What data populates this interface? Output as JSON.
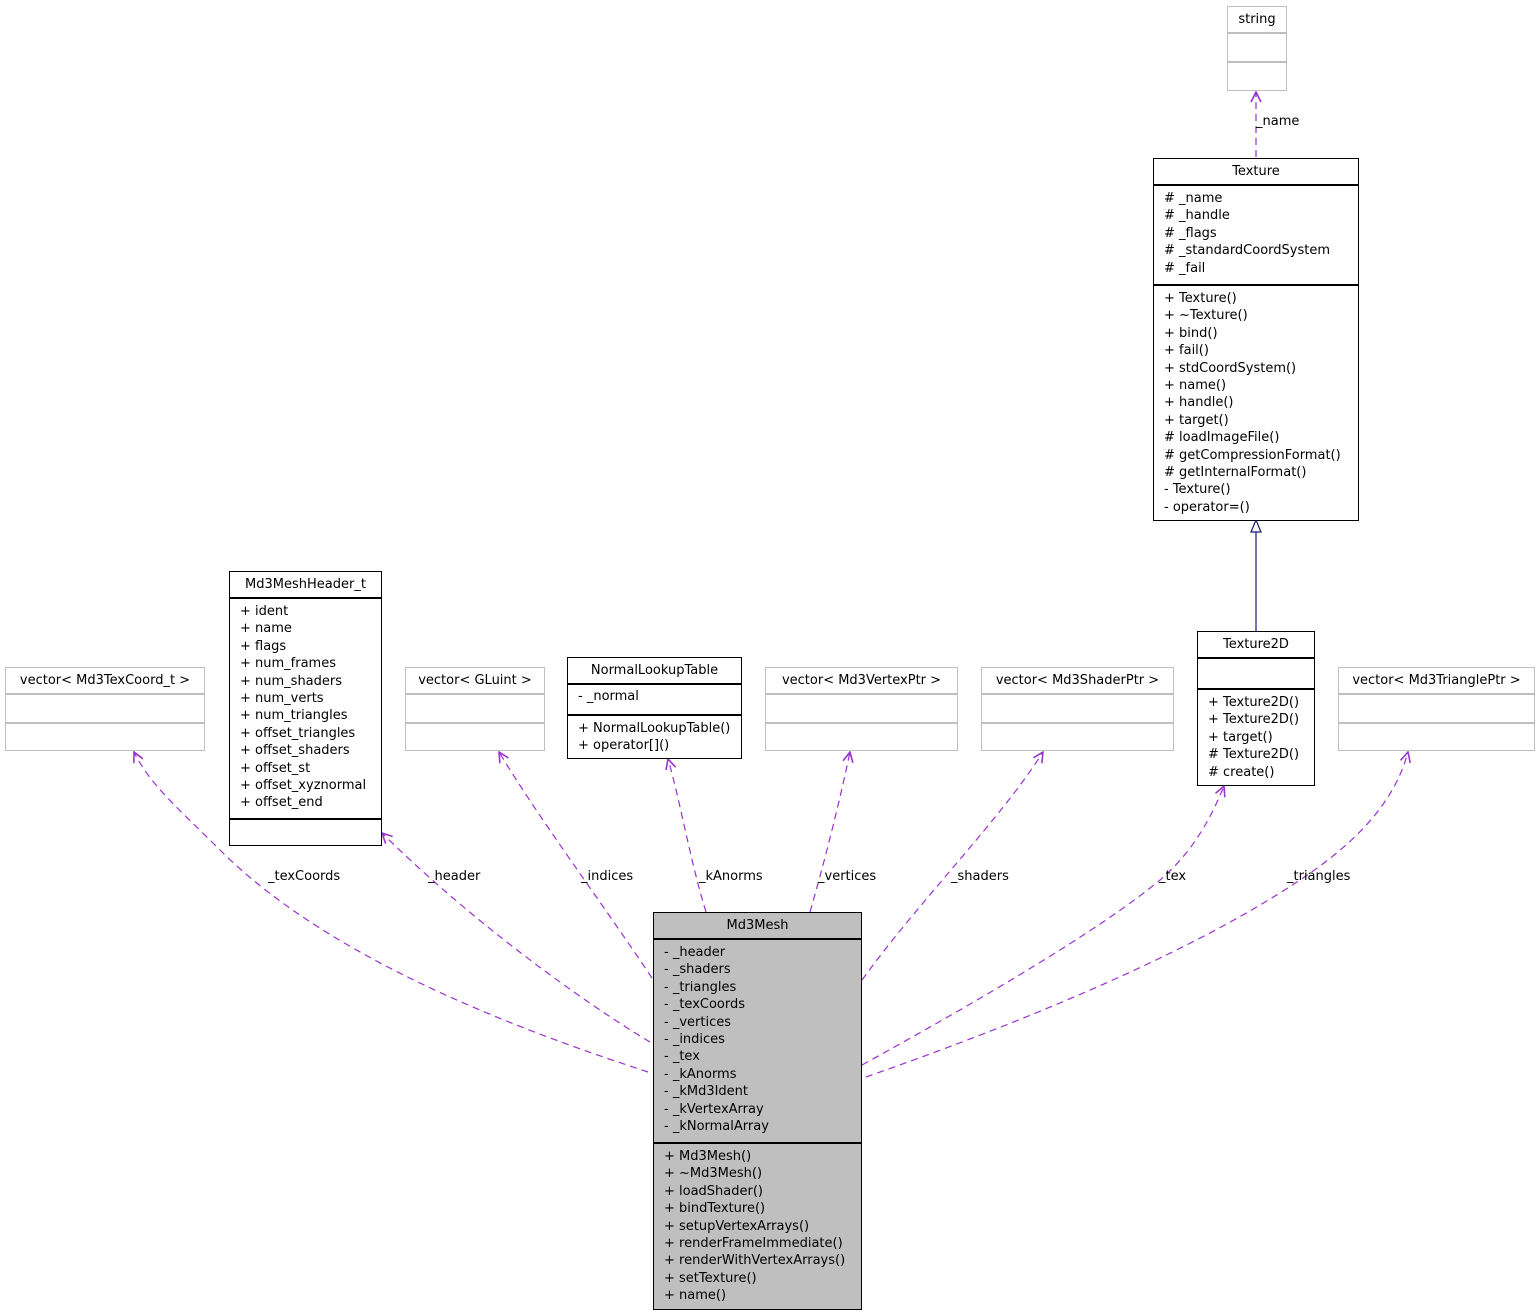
{
  "diagram": {
    "type": "uml-collaboration",
    "colors": {
      "usage_edge": "#9a32cd",
      "inheritance_edge": "#191970",
      "focus_fill": "#bfbfbf",
      "external_border": "#bfbfbf"
    },
    "classes": {
      "string": {
        "name": "string",
        "attributes": [],
        "methods": []
      },
      "texture": {
        "name": "Texture",
        "attributes": [
          "# _name",
          "# _handle",
          "# _flags",
          "# _standardCoordSystem",
          "# _fail"
        ],
        "methods": [
          "+ Texture()",
          "+ ~Texture()",
          "+ bind()",
          "+ fail()",
          "+ stdCoordSystem()",
          "+ name()",
          "+ handle()",
          "+ target()",
          "# loadImageFile()",
          "# getCompressionFormat()",
          "# getInternalFormat()",
          "- Texture()",
          "- operator=()"
        ]
      },
      "texture2d": {
        "name": "Texture2D",
        "attributes": [],
        "methods": [
          "+ Texture2D()",
          "+ Texture2D()",
          "+ target()",
          "# Texture2D()",
          "# create()"
        ]
      },
      "md3meshheader": {
        "name": "Md3MeshHeader_t",
        "attributes": [
          "+ ident",
          "+ name",
          "+ flags",
          "+ num_frames",
          "+ num_shaders",
          "+ num_verts",
          "+ num_triangles",
          "+ offset_triangles",
          "+ offset_shaders",
          "+ offset_st",
          "+ offset_xyznormal",
          "+ offset_end"
        ],
        "methods": []
      },
      "normallookup": {
        "name": "NormalLookupTable",
        "attributes": [
          "- _normal"
        ],
        "methods": [
          "+ NormalLookupTable()",
          "+ operator[]()"
        ]
      },
      "vec_texcoord": {
        "name": "vector< Md3TexCoord_t >",
        "attributes": [],
        "methods": []
      },
      "vec_gluint": {
        "name": "vector< GLuint >",
        "attributes": [],
        "methods": []
      },
      "vec_vertex": {
        "name": "vector< Md3VertexPtr >",
        "attributes": [],
        "methods": []
      },
      "vec_shader": {
        "name": "vector< Md3ShaderPtr >",
        "attributes": [],
        "methods": []
      },
      "vec_triangle": {
        "name": "vector< Md3TrianglePtr >",
        "attributes": [],
        "methods": []
      },
      "md3mesh": {
        "name": "Md3Mesh",
        "attributes": [
          "- _header",
          "- _shaders",
          "- _triangles",
          "- _texCoords",
          "- _vertices",
          "- _indices",
          "- _tex",
          "- _kAnorms",
          "- _kMd3Ident",
          "- _kVertexArray",
          "- _kNormalArray"
        ],
        "methods": [
          "+ Md3Mesh()",
          "+ ~Md3Mesh()",
          "+ loadShader()",
          "+ bindTexture()",
          "+ setupVertexArrays()",
          "+ renderFrameImmediate()",
          "+ renderWithVertexArrays()",
          "+ setTexture()",
          "+ name()"
        ]
      }
    },
    "edges": [
      {
        "from": "texture",
        "to": "string",
        "kind": "usage",
        "label": "_name"
      },
      {
        "from": "texture2d",
        "to": "texture",
        "kind": "inheritance",
        "label": ""
      },
      {
        "from": "md3mesh",
        "to": "vec_texcoord",
        "kind": "usage",
        "label": "_texCoords"
      },
      {
        "from": "md3mesh",
        "to": "md3meshheader",
        "kind": "usage",
        "label": "_header"
      },
      {
        "from": "md3mesh",
        "to": "vec_gluint",
        "kind": "usage",
        "label": "_indices"
      },
      {
        "from": "md3mesh",
        "to": "normallookup",
        "kind": "usage",
        "label": "_kAnorms"
      },
      {
        "from": "md3mesh",
        "to": "vec_vertex",
        "kind": "usage",
        "label": "_vertices"
      },
      {
        "from": "md3mesh",
        "to": "vec_shader",
        "kind": "usage",
        "label": "_shaders"
      },
      {
        "from": "md3mesh",
        "to": "texture2d",
        "kind": "usage",
        "label": "_tex"
      },
      {
        "from": "md3mesh",
        "to": "vec_triangle",
        "kind": "usage",
        "label": "_triangles"
      }
    ]
  }
}
